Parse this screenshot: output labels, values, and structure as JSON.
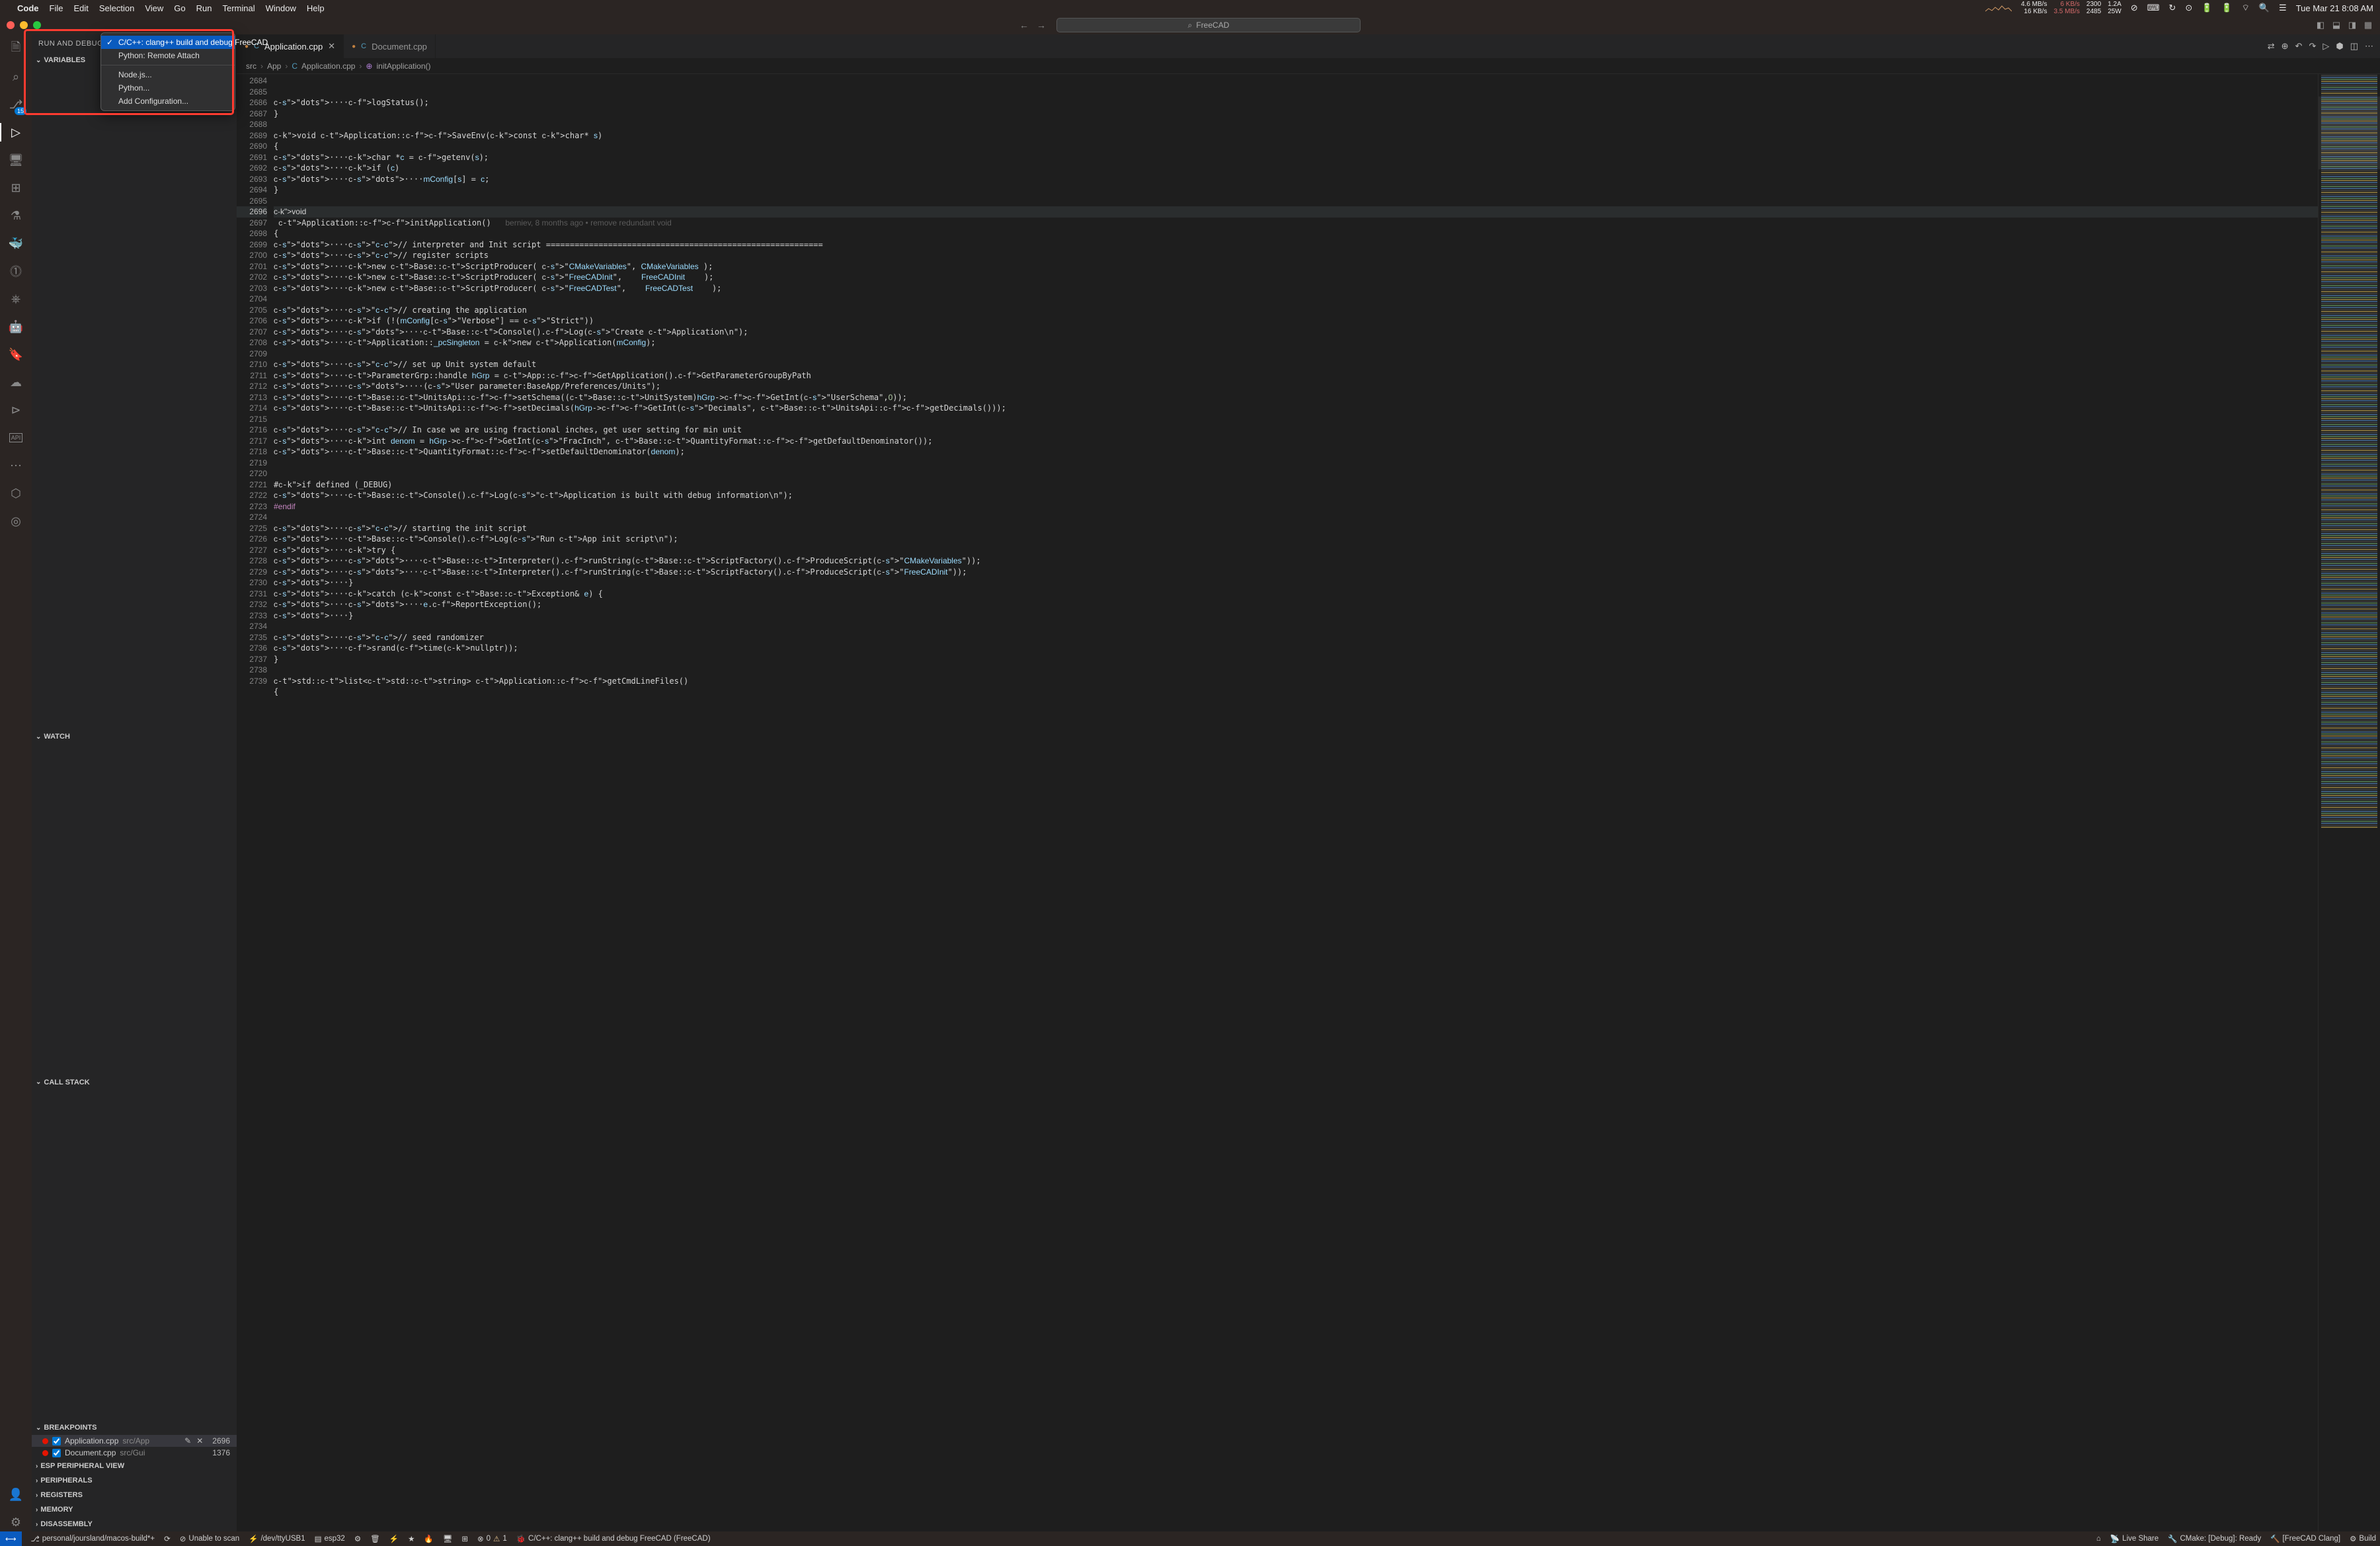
{
  "menubar": {
    "app": "Code",
    "items": [
      "File",
      "Edit",
      "Selection",
      "View",
      "Go",
      "Run",
      "Terminal",
      "Window",
      "Help"
    ],
    "net": {
      "down": "4.6 MB/s",
      "up": "16 KB/s",
      "down2": "6 KB/s",
      "up2": "3.5 MB/s"
    },
    "cpu": {
      "a": "2300",
      "b": "2485",
      "c": "1.2A",
      "d": "25W"
    },
    "clock": "Tue Mar 21  8:08 AM"
  },
  "titlebar": {
    "search_placeholder": "FreeCAD",
    "layout_icons": [
      "panel-left",
      "panel-bottom",
      "panel-right",
      "layout"
    ]
  },
  "activitybar": {
    "items": [
      {
        "name": "explorer-icon"
      },
      {
        "name": "search-icon"
      },
      {
        "name": "source-control-icon",
        "badge": "15"
      },
      {
        "name": "run-debug-icon",
        "active": true
      },
      {
        "name": "remote-explorer-icon"
      },
      {
        "name": "extensions-icon"
      },
      {
        "name": "testing-icon"
      },
      {
        "name": "docker-icon"
      },
      {
        "name": "issues-icon"
      },
      {
        "name": "kubernetes-icon"
      },
      {
        "name": "robot-icon"
      },
      {
        "name": "bookmark-icon"
      },
      {
        "name": "cloud-icon"
      },
      {
        "name": "play-icon"
      },
      {
        "name": "api-icon"
      },
      {
        "name": "dots-icon"
      },
      {
        "name": "gitlab-icon"
      },
      {
        "name": "circle-icon"
      }
    ],
    "bottom": [
      {
        "name": "accounts-icon"
      },
      {
        "name": "settings-gear-icon"
      }
    ]
  },
  "sidebar": {
    "title": "RUN AND DEBUG",
    "start_icon": "▷",
    "dropdown": {
      "selected": "C/C++: clang++ build and debug FreeCAD",
      "items": [
        "C/C++: clang++ build and debug FreeCAD",
        "Python: Remote Attach"
      ],
      "extras": [
        "Node.js...",
        "Python...",
        "Add Configuration..."
      ]
    },
    "sections": {
      "variables": "VARIABLES",
      "watch": "WATCH",
      "callstack": "CALL STACK",
      "breakpoints": "BREAKPOINTS",
      "esp": "ESP PERIPHERAL VIEW",
      "peripherals": "PERIPHERALS",
      "registers": "REGISTERS",
      "memory": "MEMORY",
      "disassembly": "DISASSEMBLY"
    },
    "breakpoints": [
      {
        "enabled": true,
        "file": "Application.cpp",
        "path": "src/App",
        "line": "2696",
        "active": true
      },
      {
        "enabled": true,
        "file": "Document.cpp",
        "path": "src/Gui",
        "line": "1376"
      }
    ]
  },
  "tabs": [
    {
      "label": "Application.cpp",
      "active": true,
      "modified": true
    },
    {
      "label": "Document.cpp",
      "active": false,
      "modified": true
    }
  ],
  "breadcrumb": [
    "src",
    "App",
    "Application.cpp",
    "initApplication()"
  ],
  "editor": {
    "first_line": 2684,
    "blame": "berniev, 8 months ago • remove redundant void",
    "lines": [
      "",
      "",
      "····logStatus();",
      "}",
      "",
      "void Application::SaveEnv(const char* s)",
      "{",
      "····char *c = getenv(s);",
      "····if (c)",
      "········mConfig[s] = c;",
      "}",
      "",
      "void Application::initApplication()",
      "{",
      "····// interpreter and Init script ==========================================================",
      "····// register scripts",
      "····new Base::ScriptProducer( \"CMakeVariables\", CMakeVariables );",
      "····new Base::ScriptProducer( \"FreeCADInit\",    FreeCADInit    );",
      "····new Base::ScriptProducer( \"FreeCADTest\",    FreeCADTest    );",
      "",
      "····// creating the application",
      "····if (!(mConfig[\"Verbose\"] == \"Strict\"))",
      "········Base::Console().Log(\"Create Application\\n\");",
      "····Application::_pcSingleton = new Application(mConfig);",
      "",
      "····// set up Unit system default",
      "····ParameterGrp::handle hGrp = App::GetApplication().GetParameterGroupByPath",
      "········(\"User parameter:BaseApp/Preferences/Units\");",
      "····Base::UnitsApi::setSchema((Base::UnitSystem)hGrp->GetInt(\"UserSchema\",0));",
      "····Base::UnitsApi::setDecimals(hGrp->GetInt(\"Decimals\", Base::UnitsApi::getDecimals()));",
      "",
      "····// In case we are using fractional inches, get user setting for min unit",
      "····int denom = hGrp->GetInt(\"FracInch\", Base::QuantityFormat::getDefaultDenominator());",
      "····Base::QuantityFormat::setDefaultDenominator(denom);",
      "",
      "",
      "#if defined (_DEBUG)",
      "····Base::Console().Log(\"Application is built with debug information\\n\");",
      "#endif",
      "",
      "····// starting the init script",
      "····Base::Console().Log(\"Run App init script\\n\");",
      "····try {",
      "········Base::Interpreter().runString(Base::ScriptFactory().ProduceScript(\"CMakeVariables\"));",
      "········Base::Interpreter().runString(Base::ScriptFactory().ProduceScript(\"FreeCADInit\"));",
      "····}",
      "····catch (const Base::Exception& e) {",
      "········e.ReportException();",
      "····}",
      "",
      "····// seed randomizer",
      "····srand(time(nullptr));",
      "}",
      "",
      "std::list<std::string> Application::getCmdLineFiles()",
      "{"
    ]
  },
  "statusbar": {
    "remote_icon": "⟷",
    "branch": "personal/joursland/macos-build*+",
    "livestatus": "Unable to scan",
    "port": "/dev/ttyUSB1",
    "chip": "esp32",
    "errors": "0",
    "warnings": "1",
    "config": "C/C++: clang++ build and debug FreeCAD (FreeCAD)",
    "liveshare": "Live Share",
    "cmake": "CMake: [Debug]: Ready",
    "kit": "[FreeCAD Clang]",
    "build": "Build"
  }
}
